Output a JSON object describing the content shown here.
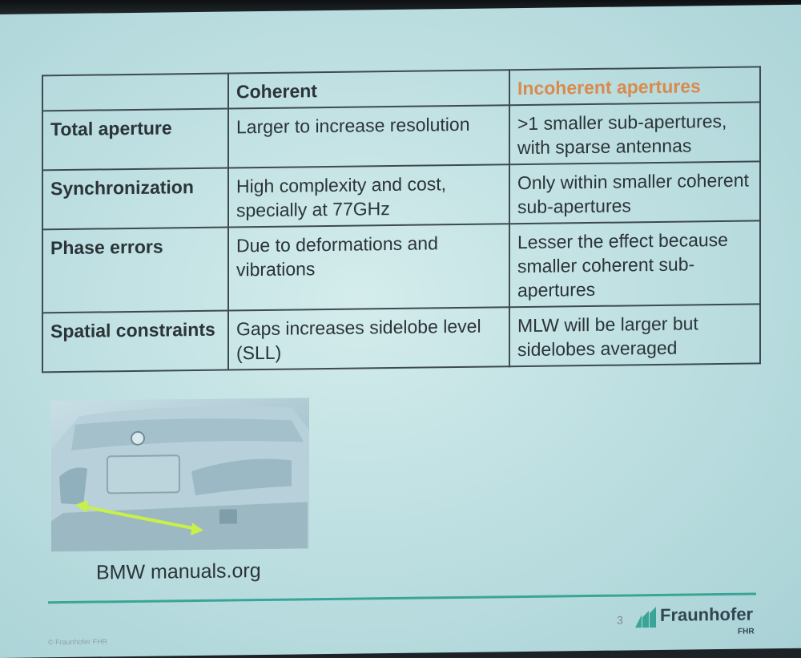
{
  "table": {
    "header": {
      "col1": "Coherent",
      "col2": "Incoherent apertures"
    },
    "rows": [
      {
        "label": "Total aperture",
        "coherent": "Larger to increase resolution",
        "incoherent": ">1 smaller sub-apertures, with sparse antennas"
      },
      {
        "label": "Synchronization",
        "coherent": "High complexity and cost, specially at 77GHz",
        "incoherent": "Only within smaller coherent sub-apertures"
      },
      {
        "label": "Phase errors",
        "coherent": "Due to deformations and vibrations",
        "incoherent": "Lesser the effect because smaller coherent sub-apertures"
      },
      {
        "label": "Spatial constraints",
        "coherent": "Gaps increases sidelobe level (SLL)",
        "incoherent": "MLW will be larger but sidelobes averaged"
      }
    ]
  },
  "image": {
    "caption": "BMW manuals.org"
  },
  "footer": {
    "page_number": "3",
    "brand": "Fraunhofer",
    "brand_sub": "FHR",
    "copyright": "© Fraunhofer FHR"
  },
  "colors": {
    "highlight_header": "#d98a4e",
    "accent_rule": "#3aa596",
    "arrow": "#c8f04a"
  }
}
